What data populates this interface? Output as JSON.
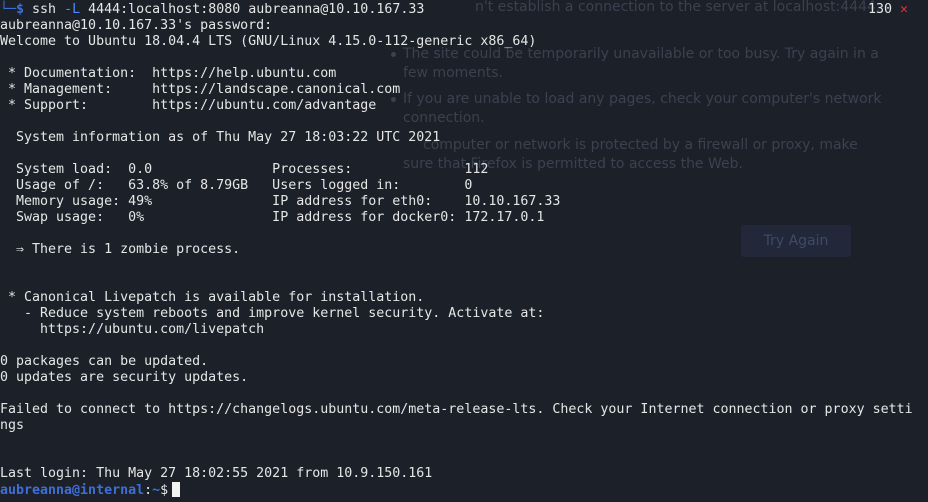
{
  "background_page": {
    "lines": [
      "n't establish a connection to the server at localhost:4444.",
      "The site could be temporarily unavailable or too busy. Try again in a",
      "few moments.",
      "If you are unable to load any pages, check your computer's network",
      "connection.",
      "computer or network is protected by a firewall or proxy, make",
      "sure that Firefox is permitted to access the Web."
    ],
    "try_again_label": "Try Again"
  },
  "status": {
    "exit_code": "130",
    "exit_mark": "✕"
  },
  "prompt": {
    "corner": "└─",
    "dollar": "$",
    "user_host": "aubreanna@internal",
    "path_sep": ":",
    "path": "~",
    "dollar2": "$"
  },
  "command": {
    "name": "ssh",
    "opt": "-L",
    "args": "4444:localhost:8080 aubreanna@10.10.167.33"
  },
  "output": [
    "aubreanna@10.10.167.33's password:",
    "Welcome to Ubuntu 18.04.4 LTS (GNU/Linux 4.15.0-112-generic x86_64)",
    "",
    " * Documentation:  https://help.ubuntu.com",
    " * Management:     https://landscape.canonical.com",
    " * Support:        https://ubuntu.com/advantage",
    "",
    "  System information as of Thu May 27 18:03:22 UTC 2021",
    "",
    "  System load:  0.0               Processes:              112",
    "  Usage of /:   63.8% of 8.79GB   Users logged in:        0",
    "  Memory usage: 49%               IP address for eth0:    10.10.167.33",
    "  Swap usage:   0%                IP address for docker0: 172.17.0.1",
    "",
    "  ⇒ There is 1 zombie process.",
    "",
    "",
    " * Canonical Livepatch is available for installation.",
    "   - Reduce system reboots and improve kernel security. Activate at:",
    "     https://ubuntu.com/livepatch",
    "",
    "0 packages can be updated.",
    "0 updates are security updates.",
    "",
    "Failed to connect to https://changelogs.ubuntu.com/meta-release-lts. Check your Internet connection or proxy setti",
    "ngs",
    "",
    "",
    "Last login: Thu May 27 18:02:55 2021 from 10.9.150.161"
  ]
}
